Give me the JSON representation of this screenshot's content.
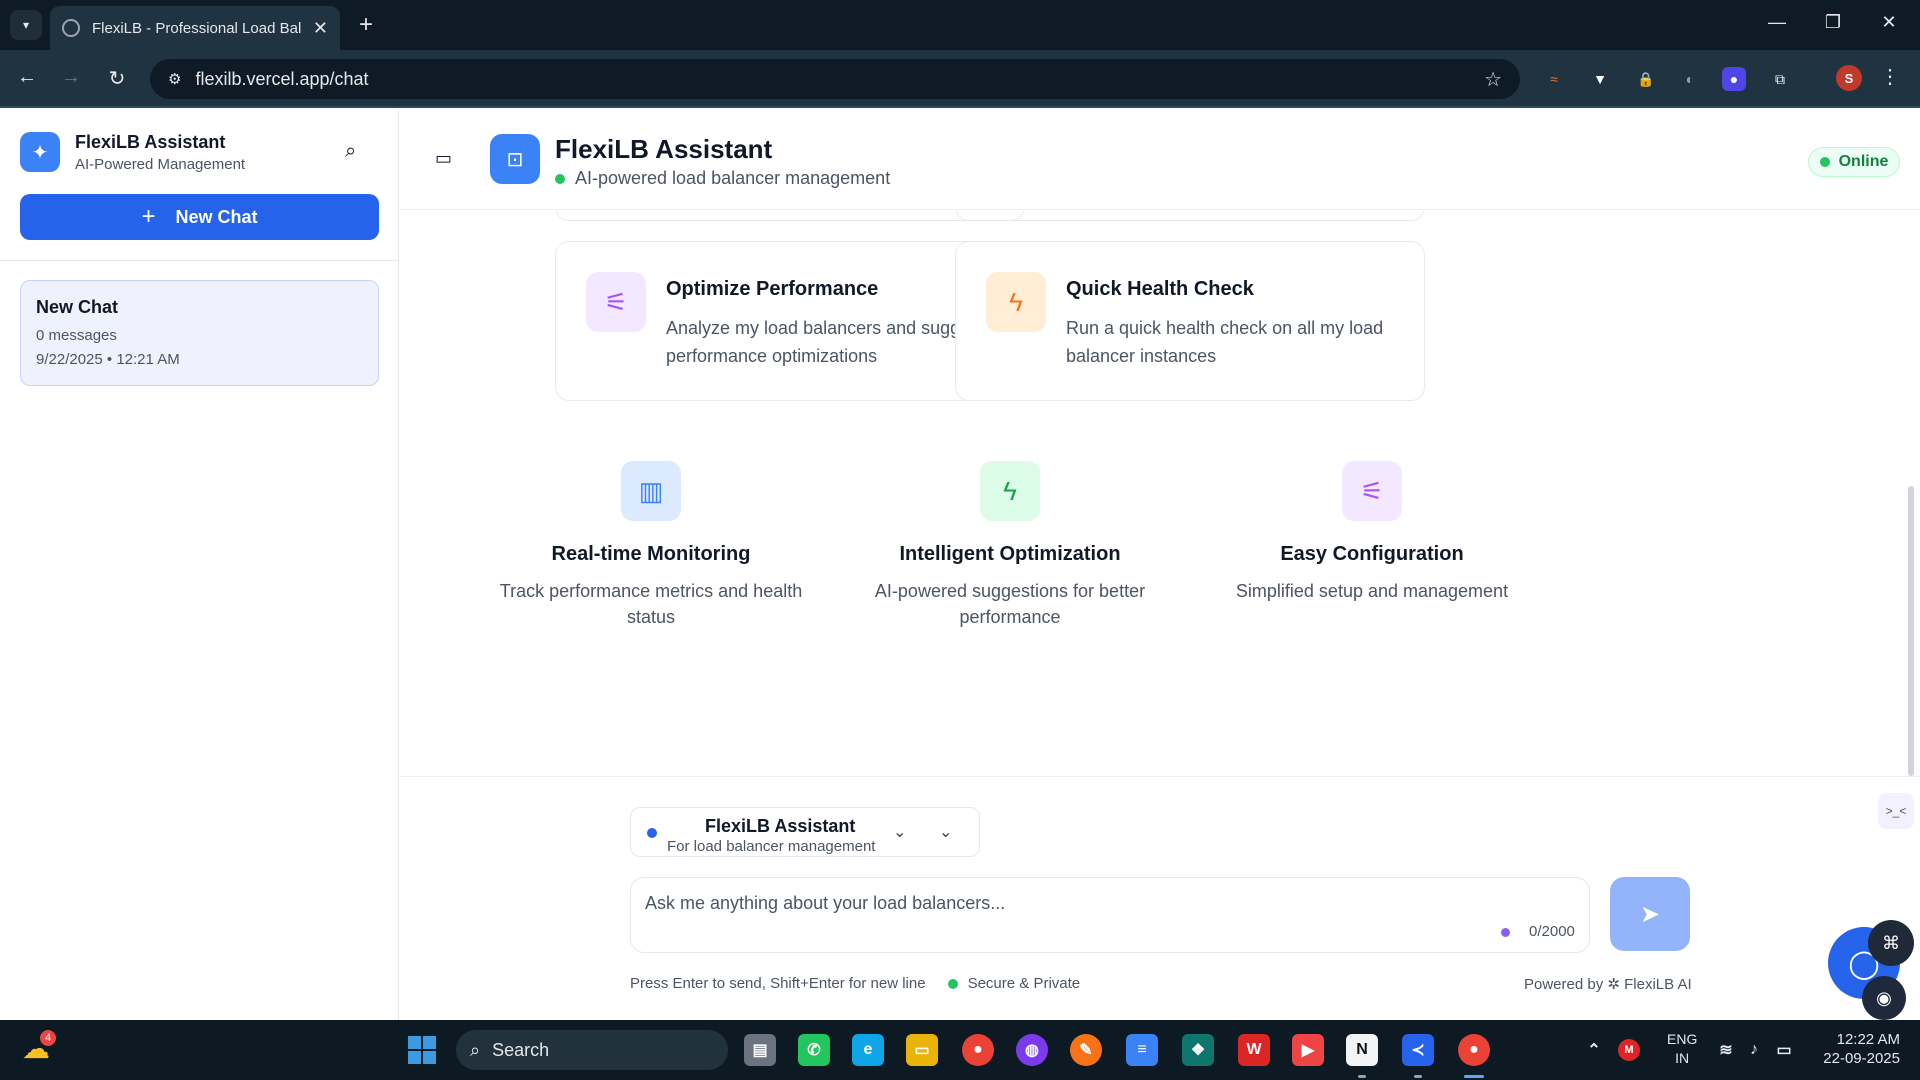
{
  "browser": {
    "tab_title": "FlexiLB - Professional Load Bala",
    "url": "flexilb.vercel.app/chat",
    "profile_initial": "S"
  },
  "sidebar": {
    "title": "FlexiLB Assistant",
    "subtitle": "AI-Powered Management",
    "new_chat_label": "New Chat",
    "chats": [
      {
        "title": "New Chat",
        "messages": "0 messages",
        "date": "9/22/2025 • 12:21 AM"
      }
    ]
  },
  "header": {
    "title": "FlexiLB Assistant",
    "subtitle": "AI-powered load balancer management",
    "status": "Online"
  },
  "quick_actions": [
    {
      "title": "Optimize Performance",
      "description": "Analyze my load balancers and suggest performance optimizations",
      "icon": "sliders-icon"
    },
    {
      "title": "Quick Health Check",
      "description": "Run a quick health check on all my load balancer instances",
      "icon": "lightning-icon"
    }
  ],
  "features": [
    {
      "title": "Real-time Monitoring",
      "description": "Track performance metrics and health status",
      "icon": "bar-chart-icon"
    },
    {
      "title": "Intelligent Optimization",
      "description": "AI-powered suggestions for better performance",
      "icon": "lightning-icon"
    },
    {
      "title": "Easy Configuration",
      "description": "Simplified setup and management",
      "icon": "sliders-icon"
    }
  ],
  "composer": {
    "model_name": "FlexiLB Assistant",
    "model_desc": "For load balancer management",
    "placeholder": "Ask me anything about your load balancers...",
    "char_count": "0/2000",
    "hint": "Press Enter to send, Shift+Enter for new line",
    "secure": "Secure & Private",
    "powered_by": "Powered by ✲ FlexiLB AI"
  },
  "taskbar": {
    "weather_badge": "4",
    "search_label": "Search",
    "lang_top": "ENG",
    "lang_bottom": "IN",
    "time": "12:22 AM",
    "date": "22-09-2025"
  },
  "colors": {
    "primary": "#2563eb",
    "online_green": "#22c55e",
    "purple_icon_bg": "#f3e8ff",
    "orange_icon_bg": "#ffedd5",
    "blue_icon_bg": "#dbeafe",
    "green_icon_bg": "#dcfce7"
  }
}
